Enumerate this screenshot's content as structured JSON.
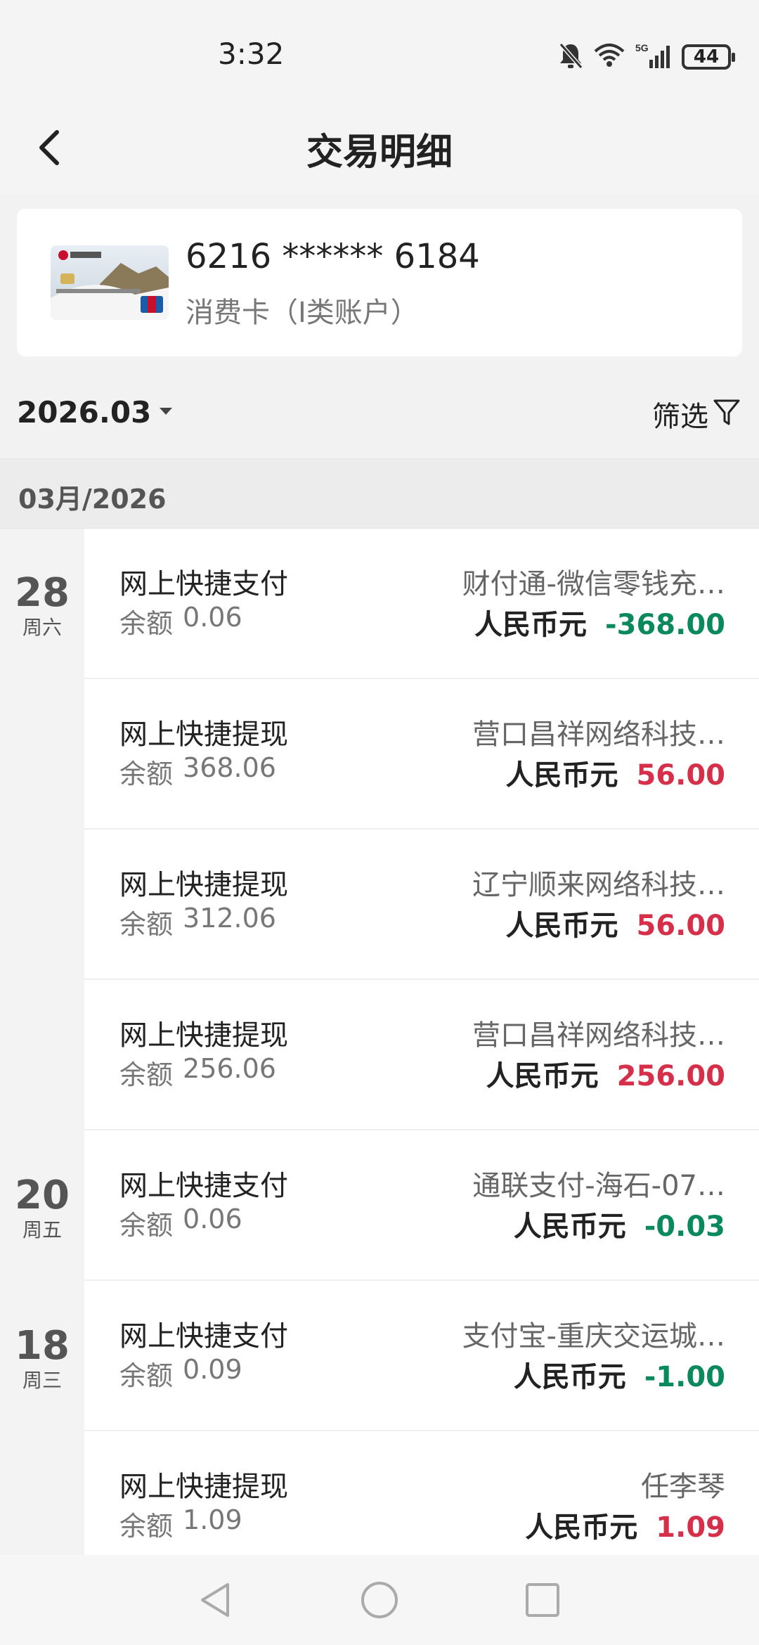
{
  "status_bar": {
    "time": "3:32",
    "battery": "44",
    "signal_label": "5G"
  },
  "header": {
    "title": "交易明细"
  },
  "card": {
    "number": "6216 ****** 6184",
    "type": "消费卡（I类账户）"
  },
  "filter": {
    "month": "2026.03",
    "filter_label": "筛选"
  },
  "group": {
    "label": "03月/2026"
  },
  "dates": [
    {
      "day": "28",
      "weekday": "周六"
    },
    {
      "day": "20",
      "weekday": "周五"
    },
    {
      "day": "18",
      "weekday": "周三"
    }
  ],
  "balance_label": "余额",
  "currency_label": "人民币元",
  "transactions": [
    {
      "title": "网上快捷支付",
      "balance": "0.06",
      "merchant": "财付通-微信零钱充…",
      "amount": "-368.00",
      "direction": "out"
    },
    {
      "title": "网上快捷提现",
      "balance": "368.06",
      "merchant": "营口昌祥网络科技…",
      "amount": "56.00",
      "direction": "in"
    },
    {
      "title": "网上快捷提现",
      "balance": "312.06",
      "merchant": "辽宁顺来网络科技…",
      "amount": "56.00",
      "direction": "in"
    },
    {
      "title": "网上快捷提现",
      "balance": "256.06",
      "merchant": "营口昌祥网络科技…",
      "amount": "256.00",
      "direction": "in"
    },
    {
      "title": "网上快捷支付",
      "balance": "0.06",
      "merchant": "通联支付-海石-07…",
      "amount": "-0.03",
      "direction": "out"
    },
    {
      "title": "网上快捷支付",
      "balance": "0.09",
      "merchant": "支付宝-重庆交运城…",
      "amount": "-1.00",
      "direction": "out"
    },
    {
      "title": "网上快捷提现",
      "balance": "1.09",
      "merchant": "任李琴",
      "amount": "1.09",
      "direction": "in"
    }
  ],
  "colors": {
    "negative": "#0a8a5c",
    "positive": "#d62f4a"
  }
}
